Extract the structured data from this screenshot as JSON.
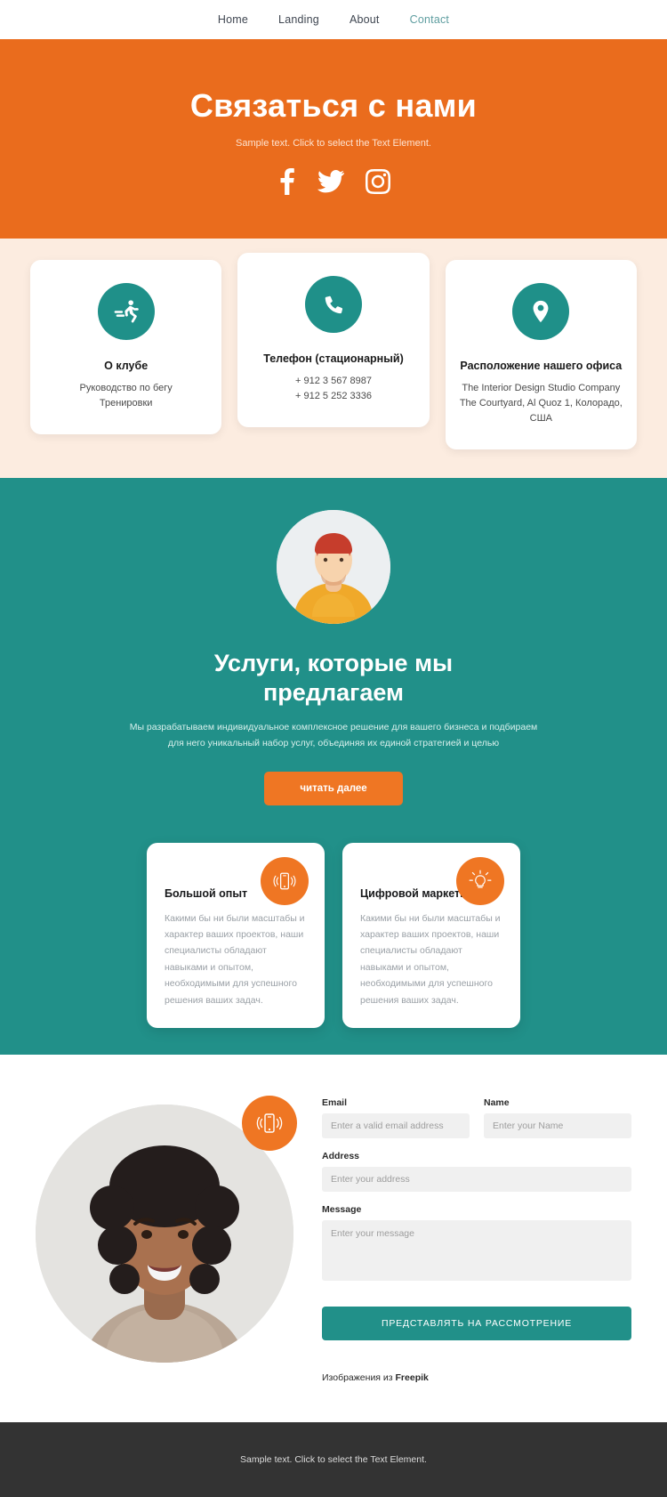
{
  "nav": {
    "items": [
      {
        "label": "Home",
        "active": false
      },
      {
        "label": "Landing",
        "active": false
      },
      {
        "label": "About",
        "active": false
      },
      {
        "label": "Contact",
        "active": true
      }
    ],
    "accent_color": "#5f9ea0"
  },
  "hero": {
    "title": "Связаться с нами",
    "subtitle": "Sample text. Click to select the Text Element.",
    "background_color": "#ea6c1d",
    "socials": [
      {
        "name": "facebook-icon"
      },
      {
        "name": "twitter-icon"
      },
      {
        "name": "instagram-icon"
      }
    ]
  },
  "contact_cards": {
    "background_color": "#fcece0",
    "icon_circle_color": "#1f9089",
    "items": [
      {
        "icon": "runner-icon",
        "title": "О клубе",
        "lines": [
          "Руководство по бегу",
          "Тренировки"
        ]
      },
      {
        "icon": "phone-icon",
        "title": "Телефон (стационарный)",
        "lines": [
          "+ 912 3 567 8987",
          "+ 912 5 252 3336"
        ]
      },
      {
        "icon": "location-pin-icon",
        "title": "Расположение нашего офиса",
        "lines": [
          "The Interior Design Studio Company",
          "The Courtyard, Al Quoz 1, Колорадо,",
          "США"
        ]
      }
    ]
  },
  "services": {
    "background_color": "#219089",
    "avatar": "portrait-man-red-beanie",
    "title": "Услуги, которые мы предлагаем",
    "paragraph": "Мы разрабатываем индивидуальное комплексное решение для вашего бизнеса и подбираем для него уникальный набор услуг, объединяя их единой стратегией и целью",
    "cta_label": "читать далее",
    "cta_color": "#ef7623",
    "features": [
      {
        "icon": "vibrating-phone-icon",
        "title": "Большой опыт",
        "body": "Какими бы ни были масштабы и характер ваших проектов, наши специалисты обладают навыками и опытом, необходимыми для успешного решения ваших задач."
      },
      {
        "icon": "lightbulb-icon",
        "title": "Цифровой маркетинг",
        "body": "Какими бы ни были масштабы и характер ваших проектов, наши специалисты обладают навыками и опытом, необходимыми для успешного решения ваших задач."
      }
    ]
  },
  "contact_form": {
    "photo": "portrait-woman-curly-hair",
    "photo_badge_icon": "vibrating-phone-icon",
    "fields": {
      "email": {
        "label": "Email",
        "placeholder": "Enter a valid email address",
        "value": ""
      },
      "name": {
        "label": "Name",
        "placeholder": "Enter your Name",
        "value": ""
      },
      "address": {
        "label": "Address",
        "placeholder": "Enter your address",
        "value": ""
      },
      "message": {
        "label": "Message",
        "placeholder": "Enter your message",
        "value": ""
      }
    },
    "submit_label": "ПРЕДСТАВЛЯТЬ НА РАССМОТРЕНИЕ",
    "submit_color": "#219089",
    "credit_prefix": "Изображения из ",
    "credit_brand": "Freepik"
  },
  "footer": {
    "text": "Sample text. Click to select the Text Element.",
    "background_color": "#333333"
  }
}
